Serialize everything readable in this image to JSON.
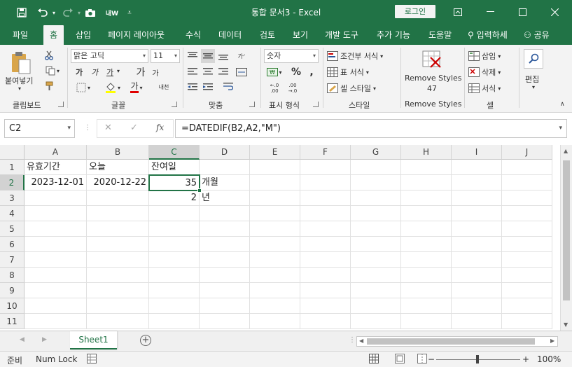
{
  "titlebar": {
    "title": "통합 문서3  -  Excel",
    "login": "로그인",
    "save_icon": "save-icon",
    "undo_icon": "undo-icon",
    "redo_icon": "redo-icon",
    "camera_icon": "camera-icon"
  },
  "tabs": [
    {
      "label": "파일"
    },
    {
      "label": "홈"
    },
    {
      "label": "삽입"
    },
    {
      "label": "페이지 레이아웃"
    },
    {
      "label": "수식"
    },
    {
      "label": "데이터"
    },
    {
      "label": "검토"
    },
    {
      "label": "보기"
    },
    {
      "label": "개발 도구"
    },
    {
      "label": "추가 기능"
    },
    {
      "label": "도움말"
    },
    {
      "label": "입력하세"
    },
    {
      "label": "공유"
    }
  ],
  "ribbon": {
    "clipboard": {
      "label": "클립보드",
      "paste": "붙여넣기"
    },
    "font": {
      "label": "글꼴",
      "name": "맑은 고딕",
      "size": "11",
      "bold": "가",
      "italic": "가",
      "underline": "가",
      "grow": "가",
      "shrink": "가",
      "color": "가",
      "phonetic": "내천"
    },
    "alignment": {
      "label": "맞춤"
    },
    "number": {
      "label": "표시 형식",
      "format": "숫자"
    },
    "styles": {
      "label": "스타일",
      "conditional": "조건부 서식",
      "table": "표 서식",
      "cell": "셀 스타일"
    },
    "remove_styles": {
      "label": "Remove Styles",
      "button": "Remove Styles",
      "count": "47"
    },
    "cells": {
      "label": "셀",
      "insert": "삽입",
      "delete": "삭제",
      "format": "서식"
    },
    "editing": {
      "label": "편집"
    }
  },
  "formula_bar": {
    "name_box": "C2",
    "formula": "=DATEDIF(B2,A2,\"M\")",
    "fx": "fx"
  },
  "grid": {
    "columns": [
      "A",
      "B",
      "C",
      "D",
      "E",
      "F",
      "G",
      "H",
      "I",
      "J"
    ],
    "rows": [
      "1",
      "2",
      "3",
      "4",
      "5",
      "6",
      "7",
      "8",
      "9",
      "10",
      "11"
    ],
    "cells": {
      "A1": "유효기간",
      "B1": "오늘",
      "C1": "잔여일",
      "A2": "2023-12-01",
      "B2": "2020-12-22",
      "C2": "35",
      "D2": "개월",
      "C3": "2",
      "D3": "년"
    }
  },
  "sheets": [
    {
      "name": "Sheet1"
    }
  ],
  "statusbar": {
    "mode": "준비",
    "numlock": "Num Lock",
    "zoom": "100%",
    "zoom_minus": "−",
    "zoom_plus": "+"
  }
}
